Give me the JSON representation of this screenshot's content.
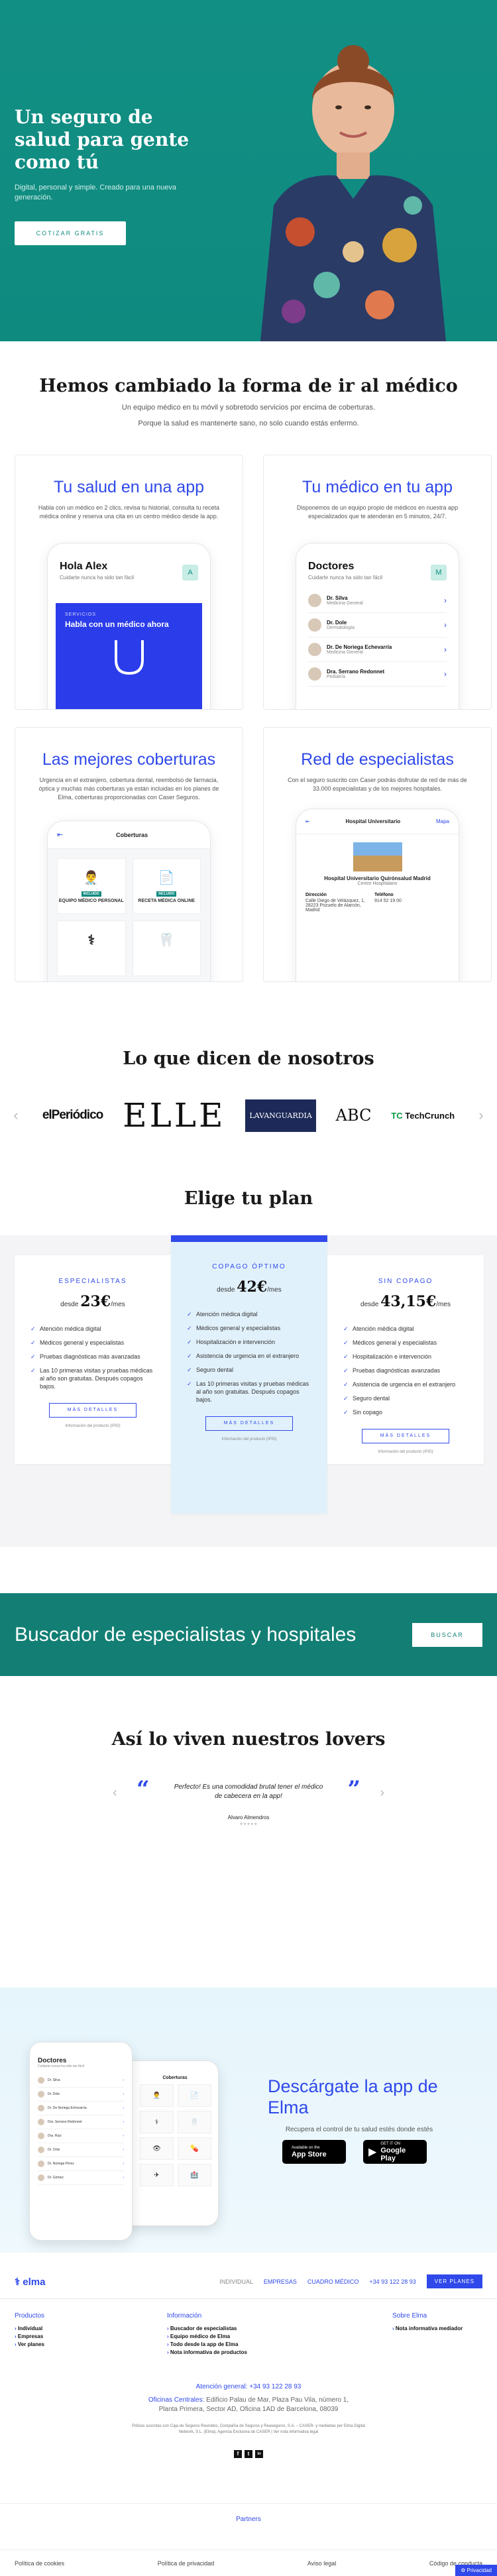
{
  "hero": {
    "title": "Un seguro de salud para gente como tú",
    "subtitle": "Digital, personal y simple. Creado para una nueva generación.",
    "cta": "COTIZAR GRATIS"
  },
  "changed": {
    "title": "Hemos cambiado la forma de ir al médico",
    "line1": "Un equipo médico en tu móvil y sobretodo servicios por encima de coberturas.",
    "line2": "Porque la salud es mantenerte sano, no solo cuando estás enfermo."
  },
  "cards": [
    {
      "title": "Tu salud en una app",
      "text": "Habla con un médico en 2 clics, revisa tu historial, consulta tu receta médica online y reserva una cita en un centro médico desde la app.",
      "phone": {
        "title": "Hola Alex",
        "sub": "Cuidarte nunca ha sido tan fácil",
        "badge": "A",
        "kicker": "SERVICIOS",
        "cta": "Habla con un médico ahora"
      }
    },
    {
      "title": "Tu médico en tu app",
      "text": "Disponemos de un equipo propio de médicos en nuestra app especializados que te atenderán en 5 minutos, 24/7.",
      "phone": {
        "title": "Doctores",
        "sub": "Cuidarte nunca ha sido tan fácil",
        "badge": "M",
        "doctors": [
          {
            "name": "Dr. Silva",
            "role": "Medicina General"
          },
          {
            "name": "Dr. Dole",
            "role": "Dermatología"
          },
          {
            "name": "Dr. De Noriega Echevarría",
            "role": "Medicina General"
          },
          {
            "name": "Dra. Serrano Redonnet",
            "role": "Pediatría"
          }
        ]
      }
    },
    {
      "title": "Las mejores coberturas",
      "text": "Urgencia en el extranjero, cobertura dental, reembolso de farmacia, óptica y muchas más coberturas ya están incluidas en los planes de Elma, coberturas proporcionadas con Caser Seguros.",
      "phone": {
        "title": "Coberturas",
        "tiles": [
          {
            "tag": "INCLUIDO",
            "label": "EQUIPO MÉDICO PERSONAL",
            "icon": "👨‍⚕️"
          },
          {
            "tag": "INCLUIDO",
            "label": "RECETA MÉDICA ONLINE",
            "icon": "📄"
          },
          {
            "tag": "",
            "label": "",
            "icon": "⚕"
          },
          {
            "tag": "",
            "label": "",
            "icon": "🦷"
          }
        ]
      }
    },
    {
      "title": "Red de especialistas",
      "text": "Con el seguro suscrito con Caser podrás disfrutar de red de más de 33.000 especialistas y de los mejores hospitales.",
      "phone": {
        "title": "Hospital Universitario",
        "map": "Mapa",
        "hospital": "Hospital Universitario Quirónsalud Madrid",
        "hospital_sub": "Centro Hospitalario",
        "address_label": "Dirección",
        "address": "Calle Diego de Velázquez, 1, 28223 Pozuelo de Alarcón, Madrid",
        "phone_label": "Teléfono",
        "phone": "914 52 19 00"
      }
    }
  ],
  "press": {
    "title": "Lo que dicen de nosotros",
    "logos": [
      "elPeriódico",
      "ELLE",
      "LAVANGUARDIA",
      "ABC",
      "TechCrunch"
    ],
    "tc_mark": "TC"
  },
  "plans": {
    "title": "Elige tu plan",
    "items": [
      {
        "name": "ESPECIALISTAS",
        "from": "desde",
        "price": "23€",
        "period": "/mes",
        "features": [
          "Atención médica digital",
          "Médicos general y especialistas",
          "Pruebas diagnósticas más avanzadas",
          "Las 10 primeras visitas y pruebas médicas al año son gratuitas. Después copagos bajos."
        ],
        "more": "MÁS DETALLES",
        "ipid": "Información del producto (IPID)"
      },
      {
        "name": "COPAGO ÓPTIMO",
        "from": "desde",
        "price": "42€",
        "period": "/mes",
        "features": [
          "Atención médica digital",
          "Médicos general y especialistas",
          "Hospitalización e intervención",
          "Asistencia de urgencia en el extranjero",
          "Seguro dental",
          "Las 10 primeras visitas y pruebas médicas al año son gratuitas. Después copagos bajos."
        ],
        "more": "MÁS DETALLES",
        "ipid": "Información del producto (IPID)"
      },
      {
        "name": "SIN COPAGO",
        "from": "desde",
        "price": "43,15€",
        "period": "/mes",
        "features": [
          "Atención médica digital",
          "Médicos general y especialistas",
          "Hospitalización e intervención",
          "Pruebas diagnósticas avanzadas",
          "Asistencia de urgencia en el extranjero",
          "Seguro dental",
          "Sin copago"
        ],
        "more": "MÁS DETALLES",
        "ipid": "Información del producto (IPID)"
      }
    ]
  },
  "search": {
    "title": "Buscador de especialistas y hospitales",
    "button": "BUSCAR"
  },
  "lovers": {
    "title": "Así lo viven nuestros lovers",
    "quote": "Perfecto! Es una comodidad brutal tener el médico de cabecera en la app!",
    "author": "Alvaro Almendros",
    "stars": "★★★★★"
  },
  "app": {
    "title": "Descárgate la app de Elma",
    "subtitle": "Recupera el control de tu salud estés donde estés",
    "phoneA": {
      "title": "Doctores",
      "sub": "Cuidarte nunca ha sido tan fácil",
      "rows": [
        "Dr. Silva",
        "Dr. Dole",
        "Dr. De Noriega Echevarría",
        "Dra. Serrano Redonnet",
        "Dra. Ruiz",
        "Dr. Ortiz",
        "Dr. Noriega Pérez",
        "Dr. Gómez"
      ]
    },
    "phoneB": {
      "title": "Coberturas"
    },
    "appstore": {
      "small": "Available on the",
      "name": "App Store"
    },
    "googleplay": {
      "small": "GET IT ON",
      "name": "Google Play"
    }
  },
  "footer": {
    "logo": "elma",
    "nav": [
      "INDIVIDUAL",
      "EMPRESAS",
      "CUADRO MÉDICO",
      "+34 93 122 28 93"
    ],
    "cta": "VER PLANES",
    "cols": [
      {
        "title": "Productos",
        "items": [
          "Individual",
          "Empresas",
          "Ver planes"
        ]
      },
      {
        "title": "Información",
        "items": [
          "Buscador de especialistas",
          "Equipo médico de Elma",
          "Todo desde la app de Elma",
          "Nota informativa de productos"
        ]
      },
      {
        "title": "Sobre Elma",
        "items": [
          "Nota informativa mediador"
        ]
      }
    ],
    "phone": "Atención general: +34 93 122 28 93",
    "addr_label": "Oficinas Centrales:",
    "addr": "Edificio Palau de Mar, Plaza Pau Vila, número 1, Planta Primera, Sector AD, Oficina 1AD de Barcelona, 08039",
    "legal": "Pólizas suscritas con Caja de Seguros Reunidos, Compañía de Seguros y Reaseguros, S.A. – CASER- y mediadas por Elma Digital Network, S.L. (Elma), Agencia Exclusiva de CASER | Ver nota informativa legal",
    "socials": [
      "f",
      "t",
      "in"
    ],
    "partners": "Partners",
    "bottom": [
      "Política de cookies",
      "Política de privacidad",
      "Aviso legal",
      "Código de conducta"
    ],
    "privacy": "Privacidad"
  }
}
